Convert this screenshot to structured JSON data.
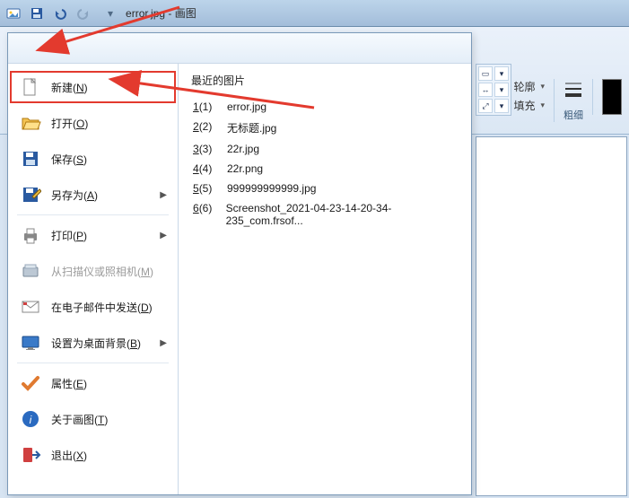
{
  "titlebar": {
    "app_title": "画图",
    "doc_name": "error.jpg",
    "separator": " - "
  },
  "menu": {
    "items": [
      {
        "label": "新建",
        "key": "N",
        "icon": "file-new-icon",
        "arrow": false,
        "hl": true,
        "disabled": false
      },
      {
        "label": "打开",
        "key": "O",
        "icon": "folder-open-icon",
        "arrow": false,
        "hl": false,
        "disabled": false
      },
      {
        "label": "保存",
        "key": "S",
        "icon": "save-icon",
        "arrow": false,
        "hl": false,
        "disabled": false
      },
      {
        "label": "另存为",
        "key": "A",
        "icon": "save-as-icon",
        "arrow": true,
        "hl": false,
        "disabled": false
      },
      {
        "label": "打印",
        "key": "P",
        "icon": "print-icon",
        "arrow": true,
        "hl": false,
        "disabled": false
      },
      {
        "label": "从扫描仪或照相机",
        "key": "M",
        "icon": "scanner-icon",
        "arrow": false,
        "hl": false,
        "disabled": true
      },
      {
        "label": "在电子邮件中发送",
        "key": "D",
        "icon": "mail-icon",
        "arrow": false,
        "hl": false,
        "disabled": false
      },
      {
        "label": "设置为桌面背景",
        "key": "B",
        "icon": "desktop-icon",
        "arrow": true,
        "hl": false,
        "disabled": false
      },
      {
        "label": "属性",
        "key": "E",
        "icon": "check-icon",
        "arrow": false,
        "hl": false,
        "disabled": false
      },
      {
        "label": "关于画图",
        "key": "T",
        "icon": "info-icon",
        "arrow": false,
        "hl": false,
        "disabled": false
      },
      {
        "label": "退出",
        "key": "X",
        "icon": "exit-icon",
        "arrow": false,
        "hl": false,
        "disabled": false
      }
    ]
  },
  "recent": {
    "header": "最近的图片",
    "items": [
      {
        "n": "1",
        "name": "error.jpg"
      },
      {
        "n": "2",
        "name": "无标题.jpg"
      },
      {
        "n": "3",
        "name": "22r.jpg"
      },
      {
        "n": "4",
        "name": "22r.png"
      },
      {
        "n": "5",
        "name": "999999999999.jpg"
      },
      {
        "n": "6",
        "name": "Screenshot_2021-04-23-14-20-34-235_com.frsof..."
      }
    ]
  },
  "ribbon": {
    "outline_label": "轮廓",
    "fill_label": "填充",
    "thickness_label": "粗细",
    "outline_swatch_color": "#000000"
  }
}
